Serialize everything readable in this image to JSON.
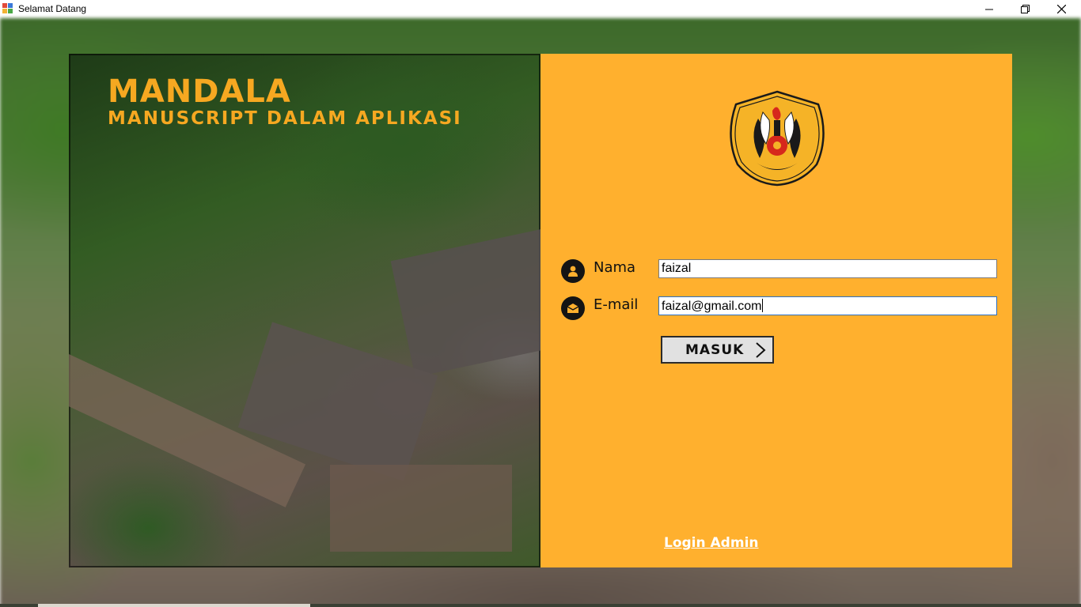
{
  "window": {
    "title": "Selamat Datang",
    "controls": [
      "minimize-icon",
      "restore-icon",
      "close-icon"
    ]
  },
  "brand": {
    "title": "MANDALA",
    "subtitle": "MANUSCRIPT DALAM APLIKASI"
  },
  "form": {
    "name": {
      "label": "Nama",
      "value": "faizal",
      "icon": "person-icon"
    },
    "email": {
      "label": "E-mail",
      "value": "faizal@gmail.com",
      "icon": "envelope-icon"
    },
    "submit_label": "MASUK",
    "admin_link": "Login Admin"
  },
  "colors": {
    "panel": "#ffb02e",
    "brand_text": "#f6a821",
    "button_bg": "#e1e1e1",
    "link": "#ffffff"
  }
}
